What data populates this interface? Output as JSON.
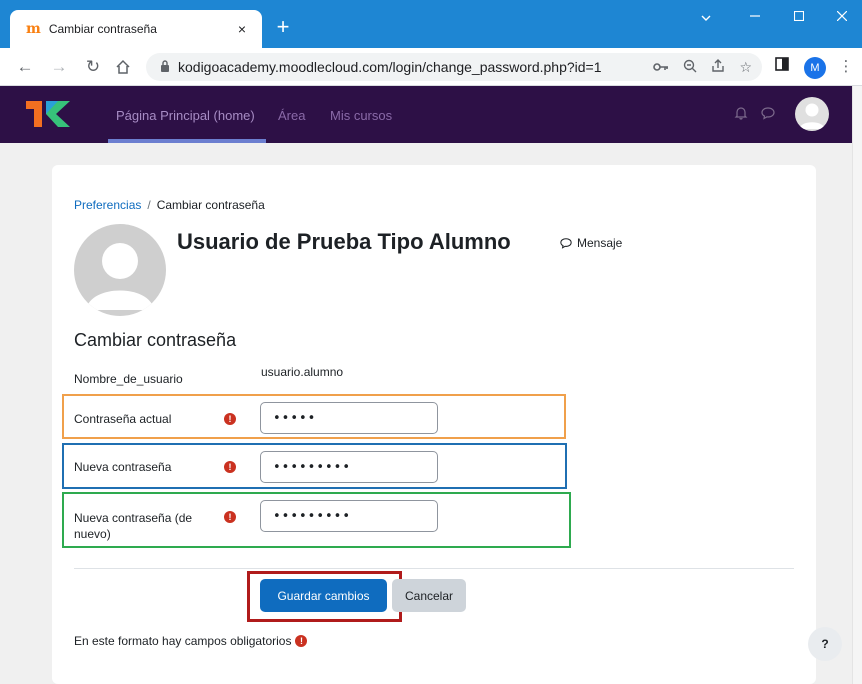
{
  "browser": {
    "tab_title": "Cambiar contraseña",
    "tab_favicon": "m",
    "tab_close": "×",
    "new_tab": "+",
    "url": "kodigoacademy.moodlecloud.com/login/change_password.php?id=1",
    "profile_initial": "M"
  },
  "navbar": {
    "items": [
      {
        "label": "Página Principal (home)"
      },
      {
        "label": "Área"
      },
      {
        "label": "Mis cursos"
      }
    ]
  },
  "breadcrumb": {
    "link": "Preferencias",
    "separator": "/",
    "current": "Cambiar contraseña"
  },
  "profile": {
    "name": "Usuario de Prueba Tipo Alumno",
    "message_label": "Mensaje"
  },
  "form": {
    "title": "Cambiar contraseña",
    "username_label": "Nombre_de_usuario",
    "username_value": "usuario.alumno",
    "current_password_label": "Contraseña actual",
    "current_password_value": "•••••",
    "new_password_label": "Nueva contraseña",
    "new_password_value": "•••••••••",
    "new_password_again_label": "Nueva contraseña (de nuevo)",
    "new_password_again_value": "•••••••••",
    "required_glyph": "!",
    "save_label": "Guardar cambios",
    "cancel_label": "Cancelar",
    "required_note": "En este formato hay campos obligatorios"
  },
  "help": {
    "label": "?"
  },
  "colors": {
    "highlight_current": "#f0a04b",
    "highlight_new": "#1f6fb2",
    "highlight_again": "#2eaa4f",
    "highlight_save": "#b01b1b",
    "navbar_bg": "#2d1046",
    "primary": "#0f6cbf"
  }
}
